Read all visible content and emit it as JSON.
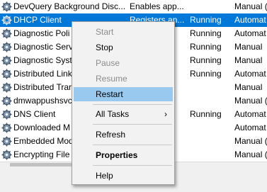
{
  "services": [
    {
      "name": "DevQuery Background Disc...",
      "description": "Enables app...",
      "status": "",
      "startup": "Manual ("
    },
    {
      "name": "DHCP Client",
      "description": "Registers an...",
      "status": "Running",
      "startup": "Automat",
      "selected": true
    },
    {
      "name": "Diagnostic Poli",
      "description": "",
      "status": "Running",
      "startup": "Automat"
    },
    {
      "name": "Diagnostic Servi",
      "description": "",
      "status": "Running",
      "startup": "Manual"
    },
    {
      "name": "Diagnostic Syst",
      "description": "",
      "status": "Running",
      "startup": "Manual"
    },
    {
      "name": "Distributed Link",
      "description": "",
      "status": "Running",
      "startup": "Automat"
    },
    {
      "name": "Distributed Trar",
      "description": "",
      "status": "",
      "startup": "Manual"
    },
    {
      "name": "dmwappushsvc",
      "description": "",
      "status": "",
      "startup": "Manual ("
    },
    {
      "name": "DNS Client",
      "description": "",
      "status": "Running",
      "startup": "Automat"
    },
    {
      "name": "Downloaded M",
      "description": "",
      "status": "",
      "startup": "Automat"
    },
    {
      "name": "Embedded Mod",
      "description": "",
      "status": "",
      "startup": "Manual ("
    },
    {
      "name": "Encrypting File",
      "description": "",
      "status": "",
      "startup": "Manual ("
    }
  ],
  "context_menu": {
    "start": "Start",
    "stop": "Stop",
    "pause": "Pause",
    "resume": "Resume",
    "restart": "Restart",
    "all_tasks": "All Tasks",
    "all_tasks_arrow": "›",
    "refresh": "Refresh",
    "properties": "Properties",
    "help": "Help"
  },
  "colors": {
    "selection": "#0078d7",
    "menu_hover": "#99c9ef",
    "menu_bg": "#f2f2f2",
    "disabled_text": "#8c8c8c"
  },
  "icons": {
    "service": "gear-icon",
    "submenu": "chevron-right-icon"
  }
}
